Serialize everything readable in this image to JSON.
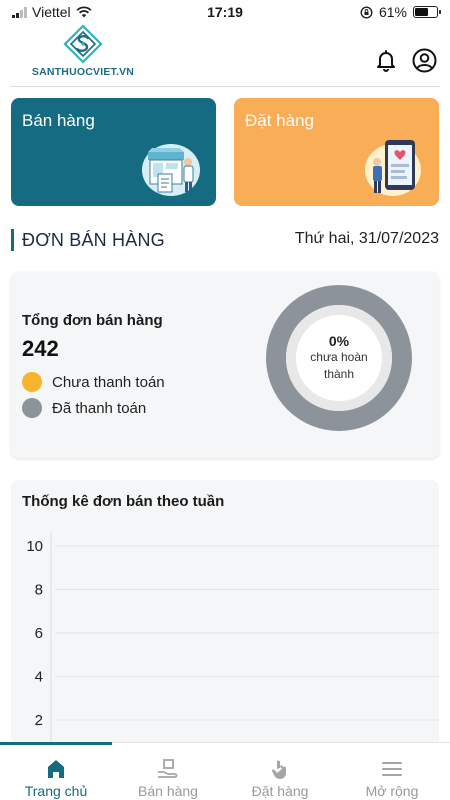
{
  "status_bar": {
    "carrier": "Viettel",
    "time": "17:19",
    "battery_percent": "61%",
    "battery_level": 0.61
  },
  "header": {
    "logo_text": "SANTHUOCVIET.VN",
    "icons": [
      "bell-icon",
      "user-circle-icon"
    ]
  },
  "actions": {
    "sell_label": "Bán hàng",
    "order_label": "Đặt hàng"
  },
  "section": {
    "title": "ĐƠN BÁN HÀNG",
    "date": "Thứ hai, 31/07/2023"
  },
  "summary": {
    "total_label": "Tổng đơn bán hàng",
    "total_count": "242",
    "legend": [
      {
        "label": "Chưa thanh toán",
        "color": "#f9b42d"
      },
      {
        "label": "Đã thanh toán",
        "color": "#8d939b"
      }
    ],
    "donut_percent": "0%",
    "donut_caption": "chưa hoàn thành"
  },
  "chart_data": {
    "type": "bar",
    "title": "Thống kê đơn bán theo tuần",
    "y_ticks": [
      10,
      8,
      6,
      4,
      2
    ],
    "ylim": [
      0,
      10
    ],
    "grid": true,
    "categories": [],
    "values": []
  },
  "bottom_nav": {
    "items": [
      {
        "label": "Trang chủ",
        "icon": "home-icon",
        "active": true
      },
      {
        "label": "Bán hàng",
        "icon": "hand-box-icon",
        "active": false
      },
      {
        "label": "Đặt hàng",
        "icon": "hand-tap-icon",
        "active": false
      },
      {
        "label": "Mở rộng",
        "icon": "menu-icon",
        "active": false
      }
    ]
  },
  "colors": {
    "primary": "#156b82",
    "order_card": "#f9ad57",
    "pending": "#f9b42d",
    "paid": "#8d939b"
  }
}
